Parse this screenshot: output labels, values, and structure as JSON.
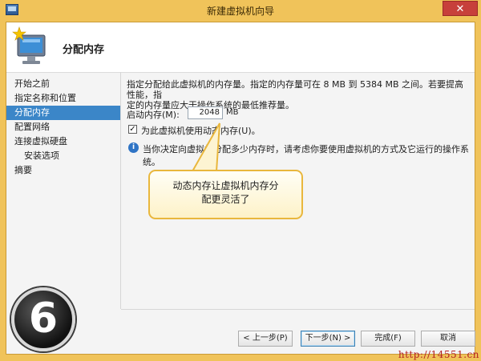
{
  "window": {
    "title": "新建虚拟机向导",
    "close_glyph": "✕"
  },
  "header": {
    "title": "分配内存",
    "icon": "monitor-star-icon"
  },
  "nav": {
    "items": [
      {
        "label": "开始之前",
        "sub": false,
        "active": false
      },
      {
        "label": "指定名称和位置",
        "sub": false,
        "active": false
      },
      {
        "label": "分配内存",
        "sub": false,
        "active": true
      },
      {
        "label": "配置网络",
        "sub": false,
        "active": false
      },
      {
        "label": "连接虚拟硬盘",
        "sub": false,
        "active": false
      },
      {
        "label": "安装选项",
        "sub": true,
        "active": false
      },
      {
        "label": "摘要",
        "sub": false,
        "active": false
      }
    ]
  },
  "content": {
    "description_line1": "指定分配给此虚拟机的内存量。指定的内存量可在 8 MB 到 5384 MB 之间。若要提高性能，指",
    "description_line2": "定的内存量应大于操作系统的最低推荐量。",
    "memory_label": "启动内存(M):",
    "memory_value": "2048",
    "memory_unit": "MB",
    "dynamic_memory_label": "为此虚拟机使用动态内存(U)。",
    "dynamic_memory_checked": true,
    "info_text": "当你决定向虚拟机分配多少内存时，请考虑你要使用虚拟机的方式及它运行的操作系统。"
  },
  "buttons": {
    "prev": "< 上一步(P)",
    "next": "下一步(N) >",
    "finish": "完成(F)",
    "cancel": "取消"
  },
  "callout": {
    "line1": "动态内存让虚拟机内存分",
    "line2": "配更灵活了"
  },
  "step_badge": "6",
  "watermark": "http://14551.cn",
  "colors": {
    "accent": "#3b86c8",
    "frame": "#f0c35a",
    "callout_border": "#e9b73d"
  }
}
